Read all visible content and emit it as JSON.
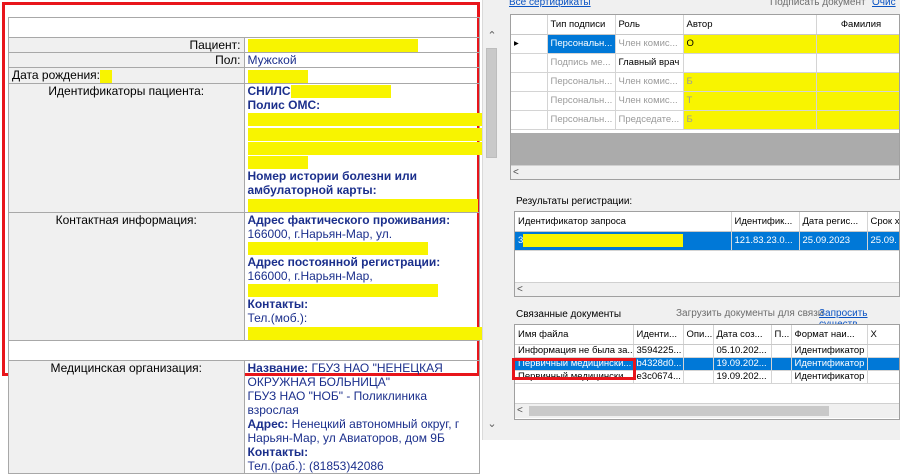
{
  "patient_card": {
    "rows": [
      {
        "label": "Пациент:",
        "value": ""
      },
      {
        "label": "Пол:",
        "value": "Мужской"
      },
      {
        "label": "Дата рождения:",
        "value": ""
      },
      {
        "label": "Идентификаторы пациента:"
      },
      {
        "label": "Контактная информация:"
      },
      {
        "label": "Медицинская организация:"
      }
    ],
    "ids": {
      "snils_label": "СНИЛС",
      "oms_label": "Полис ОМС:",
      "history_label": "Номер истории болезни или амбулаторной карты:"
    },
    "contacts": {
      "actual_label": "Адрес фактического проживания:",
      "actual_value": "166000, г.Нарьян-Мар, ул.",
      "reg_label": "Адрес постоянной регистрации:",
      "reg_value": "166000, г.Нарьян-Мар,",
      "contacts_label": "Контакты:",
      "phone_value": "Тел.(моб.):"
    },
    "org": {
      "name_label": "Название:",
      "name_value": "ГБУЗ НАО \"НЕНЕЦКАЯ ОКРУЖНАЯ БОЛЬНИЦА\"",
      "sub_value": "ГБУЗ НАО \"НОБ\" - Поликлиника взрослая",
      "addr_label": "Адрес:",
      "addr_value": "Ненецкий автономный округ, г Нарьян-Мар, ул Авиаторов, дом 9Б",
      "contacts_label": "Контакты:",
      "phone_value": "Тел.(раб.): (81853)42086"
    }
  },
  "signatures": {
    "all_certs_link": "Все сертификаты",
    "sign_doc": "Подписать документ",
    "clear_link": "Очис",
    "columns": [
      "",
      "Тип подписи",
      "Роль",
      "Автор",
      "Фамилия"
    ],
    "rows": [
      {
        "type": "Персональн...",
        "role": "Член комис...",
        "author": "О",
        "surname": ""
      },
      {
        "type": "Подпись ме...",
        "role": "Главный врач",
        "author": "",
        "surname": ""
      },
      {
        "type": "Персональн...",
        "role": "Член комис...",
        "author": "Б",
        "surname": ""
      },
      {
        "type": "Персональн...",
        "role": "Член комис...",
        "author": "Т",
        "surname": ""
      },
      {
        "type": "Персональн...",
        "role": "Председате...",
        "author": "Б",
        "surname": ""
      }
    ]
  },
  "registration": {
    "title": "Результаты регистрации:",
    "columns": [
      "Идентификатор запроса",
      "Идентифик...",
      "Дата регис...",
      "Срок х"
    ],
    "rows": [
      {
        "request_id": "3",
        "ident": "121.83.23.0...",
        "date": "25.09.2023",
        "term": "25.09."
      }
    ]
  },
  "linked": {
    "title": "Связанные документы",
    "load_btn": "Загрузить документы для связи",
    "request_link": "Запросить существ",
    "columns": [
      "Имя файла",
      "Иденти...",
      "Опи...",
      "Дата соз...",
      "П...",
      "Формат наи...",
      "Х"
    ],
    "rows": [
      {
        "name": "Информация не была за...",
        "id": "3594225...",
        "desc": "",
        "date": "05.10.202...",
        "p": "",
        "format": "Идентификатор"
      },
      {
        "name": "Первичный медицински...",
        "id": "b4328d0...",
        "desc": "",
        "date": "19.09.202...",
        "p": "",
        "format": "Идентификатор"
      },
      {
        "name": "Первичный медицински...",
        "id": "e3c0674...",
        "desc": "",
        "date": "19.09.202...",
        "p": "",
        "format": "Идентификатор"
      }
    ]
  },
  "colors": {
    "highlight": "#f8f400",
    "red_frame": "#e8151b",
    "selection": "#0078d7",
    "link": "#0a53c3"
  }
}
